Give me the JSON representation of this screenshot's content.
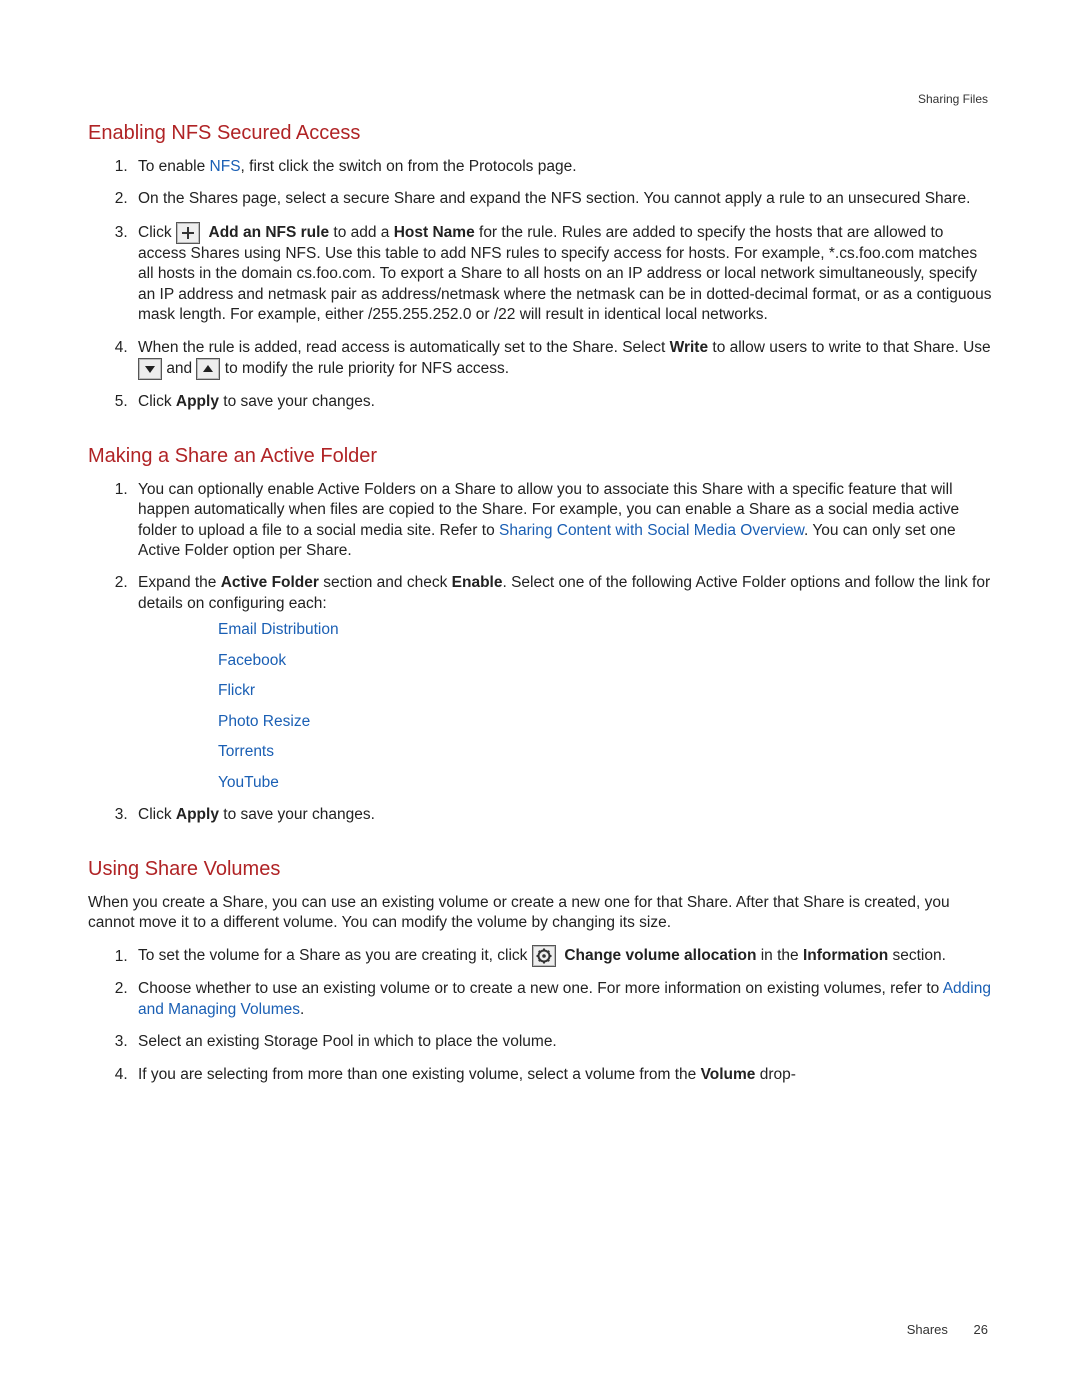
{
  "header_label": "Sharing Files",
  "section1": {
    "title": "Enabling NFS Secured Access",
    "step1_a": "To enable ",
    "step1_link": "NFS",
    "step1_b": ", first click the switch on from the Protocols page.",
    "step2": "On the Shares page, select a secure Share and expand the NFS section. You cannot apply a rule to an unsecured Share.",
    "step3_a": "Click ",
    "step3_bold1": "Add an NFS rule",
    "step3_b": " to add a ",
    "step3_bold2": "Host Name",
    "step3_c": " for the rule. Rules are added to specify the hosts that are allowed to access Shares using NFS. Use this table to add NFS rules to specify access for hosts. For example, *.cs.foo.com matches all hosts in the domain cs.foo.com. To export a Share to all hosts on an IP address or local network simultaneously, specify an IP address and netmask pair as address/netmask where the netmask can be in dotted-decimal format, or as a contiguous mask length. For example, either /255.255.252.0 or /22 will result in identical local networks.",
    "step4_a": "When the rule is added, read access is automatically set to the Share. Select ",
    "step4_bold1": "Write",
    "step4_b": " to allow users to write to that Share. Use ",
    "step4_c": " and ",
    "step4_d": " to modify the rule priority for NFS access.",
    "step5_a": "Click ",
    "step5_bold": "Apply",
    "step5_b": " to save your changes."
  },
  "section2": {
    "title": "Making a Share an Active Folder",
    "step1_a": "You can optionally enable Active Folders on a Share to allow you to associate this Share with a specific feature that will happen automatically when files are copied to the Share. For example, you can enable a Share as a social media active folder to upload a file to a social media site. Refer to ",
    "step1_link": "Sharing Content with Social Media Overview",
    "step1_b": ". You can only set one Active Folder option per Share.",
    "step2_a": "Expand the ",
    "step2_bold1": "Active Folder",
    "step2_b": " section and check ",
    "step2_bold2": "Enable",
    "step2_c": ". Select one of the following Active Folder options and follow the link for details on configuring each:",
    "links": {
      "l1": "Email Distribution",
      "l2": "Facebook",
      "l3": "Flickr",
      "l4": "Photo Resize",
      "l5": "Torrents",
      "l6": "YouTube"
    },
    "step3_a": "Click ",
    "step3_bold": "Apply",
    "step3_b": " to save your changes."
  },
  "section3": {
    "title": "Using Share Volumes",
    "intro": "When you create a Share, you can use an existing volume or create a new one for that Share. After that Share is created, you cannot move it to a different volume. You can modify the volume by changing its size.",
    "step1_a": "To set the volume for a Share as you are creating it, click ",
    "step1_bold1": "Change volume allocation",
    "step1_b": " in the ",
    "step1_bold2": "Information",
    "step1_c": " section.",
    "step2_a": "Choose whether to use an existing volume or to create a new one. For more information on existing volumes, refer to ",
    "step2_link": "Adding and Managing Volumes",
    "step2_b": ".",
    "step3": "Select an existing Storage Pool in which to place the volume.",
    "step4_a": "If you are selecting from more than one existing volume, select a volume from the ",
    "step4_bold": "Volume",
    "step4_b": " drop-"
  },
  "footer": {
    "label": "Shares",
    "page": "26"
  }
}
